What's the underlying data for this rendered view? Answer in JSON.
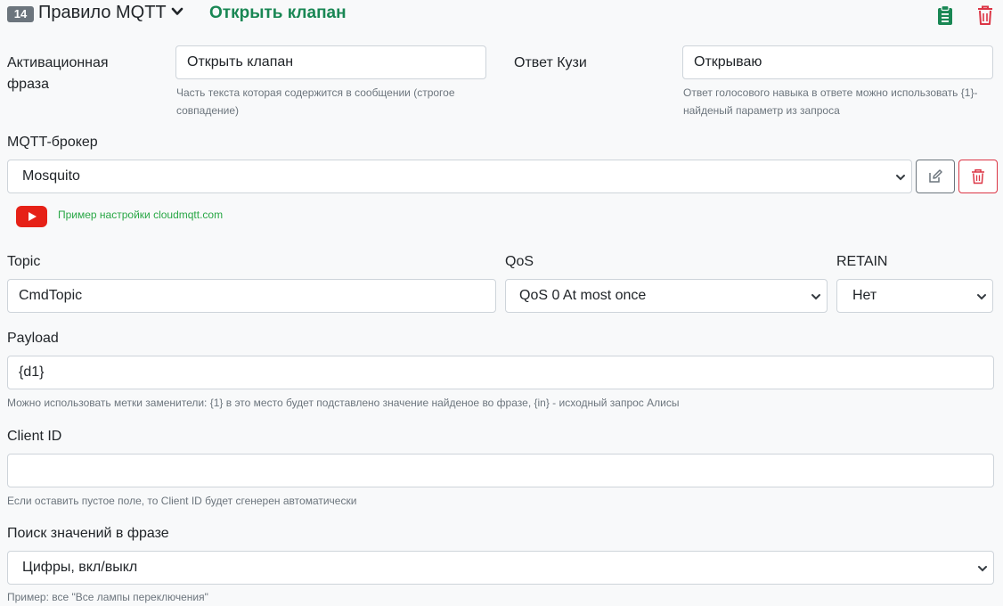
{
  "header": {
    "number": "14",
    "title": "Правило MQTT",
    "phrase": "Открыть клапан"
  },
  "activation": {
    "label": "Активационная фраза",
    "value": "Открыть клапан",
    "help": "Часть текста которая содержится в сообщении (строгое совпадение)"
  },
  "answer": {
    "label": "Ответ Кузи",
    "value": "Открываю",
    "help": "Ответ голосового навыка в ответе можно использовать {1}- найденый параметр из запроса"
  },
  "broker": {
    "label": "MQTT-брокер",
    "selected": "Mosquito",
    "example_link": "Пример настройки cloudmqtt.com"
  },
  "topic": {
    "label": "Topic",
    "value": "CmdTopic"
  },
  "qos": {
    "label": "QoS",
    "selected": "QoS 0 At most once"
  },
  "retain": {
    "label": "RETAIN",
    "selected": "Нет"
  },
  "payload": {
    "label": "Payload",
    "value": "{d1}",
    "help": "Можно использовать метки заменители: {1} в это место будет подставлено значение найденое во фразе, {in} - исходный запрос Алисы"
  },
  "client_id": {
    "label": "Client ID",
    "value": "",
    "help": "Если оставить пустое поле, то Client ID будет сгенерен автоматически"
  },
  "search": {
    "label": "Поиск значений в фразе",
    "selected": "Цифры, вкл/выкл",
    "help": "Пример: все \"Все лампы переключения\""
  },
  "colors": {
    "accent_green": "#198754",
    "danger_red": "#dc3545",
    "youtube_red": "#e62117",
    "link_green": "#28a745"
  },
  "icons": [
    "chevron-down-icon",
    "clipboard-icon",
    "trash-icon",
    "edit-icon",
    "youtube-icon"
  ]
}
